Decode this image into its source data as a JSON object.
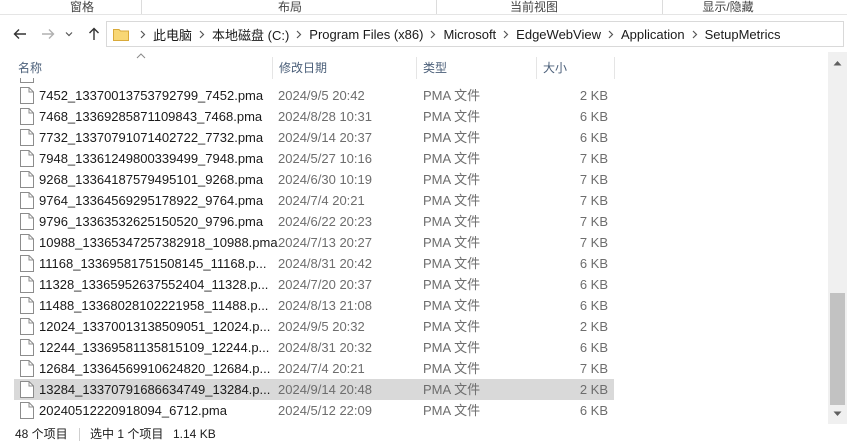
{
  "ribbon": {
    "groups": [
      "窗格",
      "布局",
      "当前视图",
      "显示/隐藏"
    ]
  },
  "nav": {
    "back_icon": "arrow-left-icon",
    "forward_icon": "arrow-right-icon",
    "recent_icon": "chevron-down-icon",
    "up_icon": "arrow-up-icon"
  },
  "address": {
    "folder_icon": "folder-icon",
    "crumbs": [
      "此电脑",
      "本地磁盘 (C:)",
      "Program Files (x86)",
      "Microsoft",
      "EdgeWebView",
      "Application",
      "SetupMetrics"
    ]
  },
  "columns": {
    "name": "名称",
    "date": "修改日期",
    "type": "类型",
    "size": "大小"
  },
  "files": [
    {
      "name": "7452_13370013753792799_7452.pma",
      "date": "2024/9/5 20:42",
      "type": "PMA 文件",
      "size": "2 KB"
    },
    {
      "name": "7468_13369285871109843_7468.pma",
      "date": "2024/8/28 10:31",
      "type": "PMA 文件",
      "size": "6 KB"
    },
    {
      "name": "7732_13370791071402722_7732.pma",
      "date": "2024/9/14 20:37",
      "type": "PMA 文件",
      "size": "6 KB"
    },
    {
      "name": "7948_13361249800339499_7948.pma",
      "date": "2024/5/27 10:16",
      "type": "PMA 文件",
      "size": "7 KB"
    },
    {
      "name": "9268_13364187579495101_9268.pma",
      "date": "2024/6/30 10:19",
      "type": "PMA 文件",
      "size": "7 KB"
    },
    {
      "name": "9764_13364569295178922_9764.pma",
      "date": "2024/7/4 20:21",
      "type": "PMA 文件",
      "size": "7 KB"
    },
    {
      "name": "9796_13363532625150520_9796.pma",
      "date": "2024/6/22 20:23",
      "type": "PMA 文件",
      "size": "7 KB"
    },
    {
      "name": "10988_13365347257382918_10988.pma",
      "date": "2024/7/13 20:27",
      "type": "PMA 文件",
      "size": "7 KB"
    },
    {
      "name": "11168_13369581751508145_11168.p...",
      "date": "2024/8/31 20:42",
      "type": "PMA 文件",
      "size": "6 KB"
    },
    {
      "name": "11328_13365952637552404_11328.p...",
      "date": "2024/7/20 20:37",
      "type": "PMA 文件",
      "size": "6 KB"
    },
    {
      "name": "11488_13368028102221958_11488.p...",
      "date": "2024/8/13 21:08",
      "type": "PMA 文件",
      "size": "6 KB"
    },
    {
      "name": "12024_13370013138509051_12024.p...",
      "date": "2024/9/5 20:32",
      "type": "PMA 文件",
      "size": "2 KB"
    },
    {
      "name": "12244_13369581135815109_12244.p...",
      "date": "2024/8/31 20:32",
      "type": "PMA 文件",
      "size": "6 KB"
    },
    {
      "name": "12684_13364569910624820_12684.p...",
      "date": "2024/7/4 20:21",
      "type": "PMA 文件",
      "size": "7 KB"
    },
    {
      "name": "13284_13370791686634749_13284.p...",
      "date": "2024/9/14 20:48",
      "type": "PMA 文件",
      "size": "2 KB",
      "selected": true
    },
    {
      "name": "20240512220918094_6712.pma",
      "date": "2024/5/12 22:09",
      "type": "PMA 文件",
      "size": "6 KB"
    }
  ],
  "file_icon": "file-icon",
  "status": {
    "item_count": "48 个项目",
    "selected": "选中 1 个项目",
    "selected_size": "1.14 KB"
  },
  "scrollbar": {
    "up_icon": "scroll-up-icon",
    "down_icon": "scroll-down-icon",
    "position_fraction": 0.73
  }
}
